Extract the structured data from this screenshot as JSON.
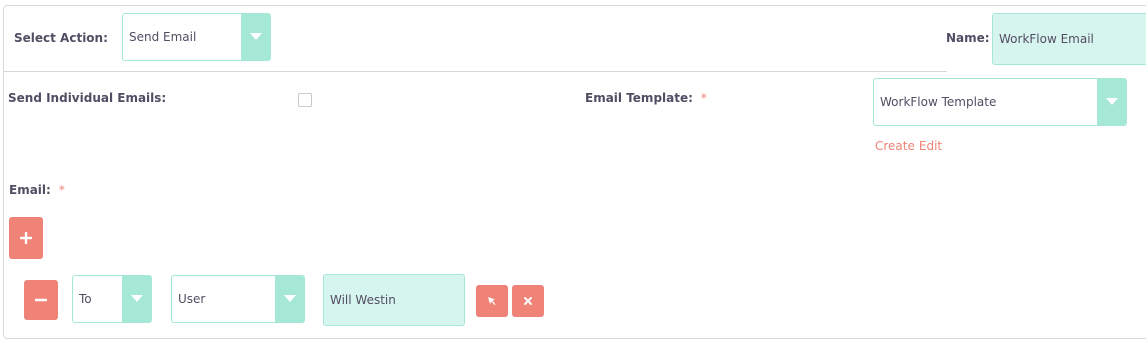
{
  "header": {
    "select_action_label": "Select Action:",
    "select_action_value": "Send Email",
    "name_label": "Name:",
    "name_value": "WorkFlow Email"
  },
  "form": {
    "send_individual_label": "Send Individual Emails:",
    "send_individual_checked": false,
    "email_template_label": "Email Template:",
    "email_template_required": "*",
    "email_template_value": "WorkFlow Template",
    "create_link": "Create",
    "edit_link": "Edit",
    "email_label": "Email:",
    "email_required": "*"
  },
  "recipient_row": {
    "to_value": "To",
    "type_value": "User",
    "user_value": "Will Westin"
  },
  "icons": {
    "add": "plus-icon",
    "remove": "minus-icon",
    "select": "select-arrow-icon",
    "clear": "close-icon",
    "dropdown": "chevron-down-icon"
  },
  "colors": {
    "accent_teal": "#a5e8d6",
    "field_fill": "#d6f5ee",
    "button_coral": "#f08377",
    "text": "#534d64"
  }
}
